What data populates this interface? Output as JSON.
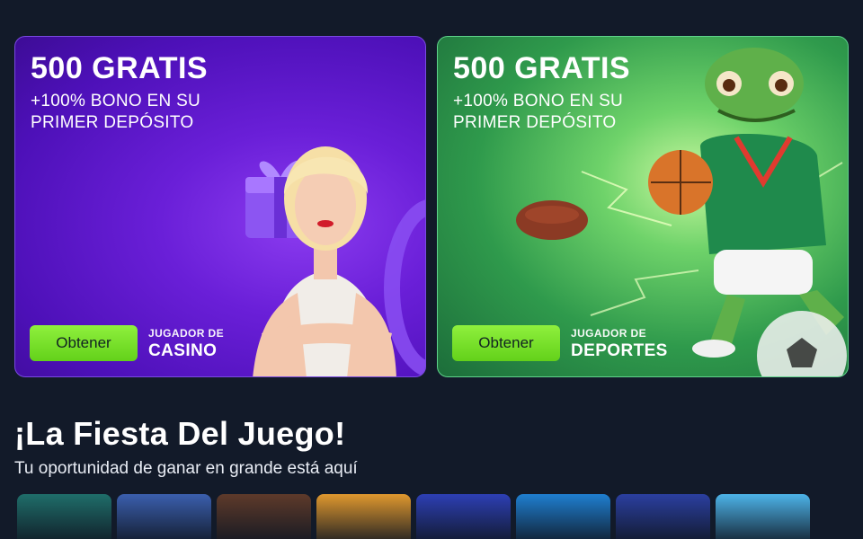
{
  "promos": [
    {
      "title": "500 GRATIS",
      "subtitle": "+100% BONO EN SU PRIMER DEPÓSITO",
      "button": "Obtener",
      "player_top": "JUGADOR DE",
      "player_main": "CASINO"
    },
    {
      "title": "500 GRATIS",
      "subtitle": "+100% BONO EN SU PRIMER DEPÓSITO",
      "button": "Obtener",
      "player_top": "JUGADOR DE",
      "player_main": "DEPORTES"
    }
  ],
  "section": {
    "title": "¡La Fiesta Del Juego!",
    "subtitle": "Tu oportunidad de ganar en grande está aquí"
  },
  "games": [
    {
      "icon": "mermaid-tile-icon",
      "color": "#1f6e6a"
    },
    {
      "icon": "sea-queen-tile-icon",
      "color": "#3b5fae"
    },
    {
      "icon": "warriors-tile-icon",
      "color": "#5e3a2a"
    },
    {
      "icon": "fiesta-girl-tile-icon",
      "color": "#e0982e"
    },
    {
      "icon": "astronaut-tile-icon",
      "color": "#2d3fb4"
    },
    {
      "icon": "dragons-tile-icon",
      "color": "#1f7fd0"
    },
    {
      "icon": "zeus-tile-icon",
      "color": "#2b3fa0"
    },
    {
      "icon": "pig-tile-icon",
      "color": "#4db3e8"
    }
  ],
  "colors": {
    "background": "#121a29",
    "button_green": "#7ee82a",
    "casino_purple": "#6a1fd8",
    "sports_green": "#2f9a4c"
  }
}
